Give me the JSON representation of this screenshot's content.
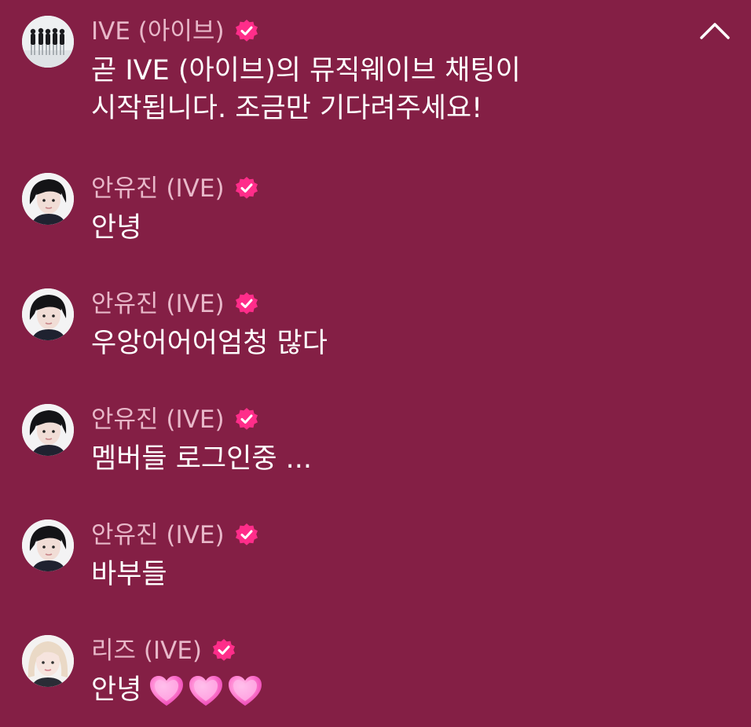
{
  "chat": {
    "messages": [
      {
        "avatar": "group-photo",
        "name": "IVE (아이브)",
        "verified": true,
        "text": "곧 IVE (아이브)의 뮤직웨이브 채팅이\n시작됩니다. 조금만 기다려주세요!"
      },
      {
        "avatar": "member-photo",
        "name": "안유진 (IVE)",
        "verified": true,
        "text": "안녕"
      },
      {
        "avatar": "member-photo",
        "name": "안유진 (IVE)",
        "verified": true,
        "text": "우앙어어어엄청 많다"
      },
      {
        "avatar": "member-photo",
        "name": "안유진 (IVE)",
        "verified": true,
        "text": "멤버들 로그인중 ..."
      },
      {
        "avatar": "member-photo",
        "name": "안유진 (IVE)",
        "verified": true,
        "text": "바부들"
      },
      {
        "avatar": "member-photo-blonde",
        "name": "리즈 (IVE)",
        "verified": true,
        "text": "안녕",
        "emoji": [
          "pink-heart",
          "pink-heart",
          "pink-heart"
        ]
      }
    ]
  },
  "colors": {
    "background": "#841f45",
    "name": "#e8b8c9",
    "text": "#ffffff",
    "badge": "#ff2d8a"
  },
  "icons": {
    "collapse": "chevron-up-icon",
    "verified": "verified-badge-icon"
  }
}
